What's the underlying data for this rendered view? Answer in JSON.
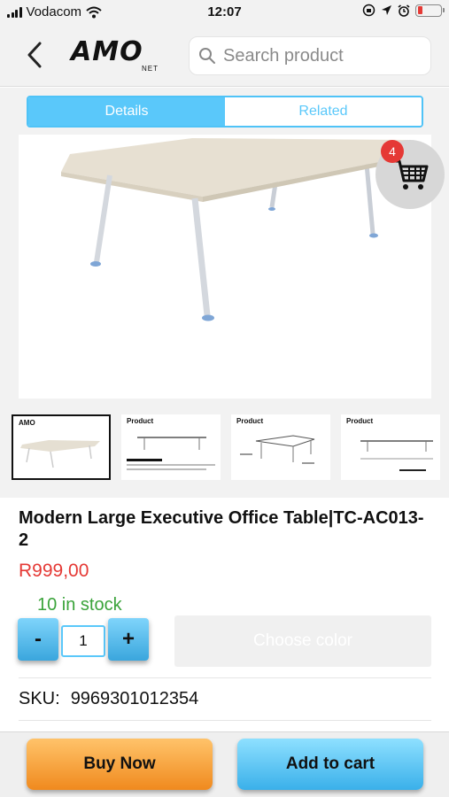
{
  "status_bar": {
    "carrier": "Vodacom",
    "time": "12:07",
    "battery_level": 0.2
  },
  "header": {
    "logo_text": "AMO",
    "logo_sub": "NET",
    "search_placeholder": "Search product"
  },
  "tabs": [
    {
      "label": "Details",
      "active": true
    },
    {
      "label": "Related",
      "active": false
    }
  ],
  "cart": {
    "badge_count": "4"
  },
  "thumbnails": {
    "first_logo": "AMO",
    "labels": [
      "Product",
      "Product",
      "Product"
    ]
  },
  "product": {
    "title": "Modern Large Executive Office Table|TC-AC013-2",
    "price": "R999,00",
    "stock": "10 in stock",
    "quantity": "1",
    "qty_minus": "-",
    "qty_plus": "+",
    "color_button": "Choose color",
    "sku_label": "SKU:",
    "sku_value": "9969301012354"
  },
  "actions": {
    "buy_now": "Buy Now",
    "add_to_cart": "Add to cart"
  },
  "colors": {
    "accent_blue": "#5ac8fa",
    "price_red": "#e53935",
    "stock_green": "#3aa33a",
    "buy_orange": "#f08a1e"
  },
  "icons": [
    "signal-icon",
    "wifi-icon",
    "rotation-lock-icon",
    "location-icon",
    "alarm-icon",
    "battery-icon",
    "back-chevron-icon",
    "search-icon",
    "cart-icon"
  ]
}
